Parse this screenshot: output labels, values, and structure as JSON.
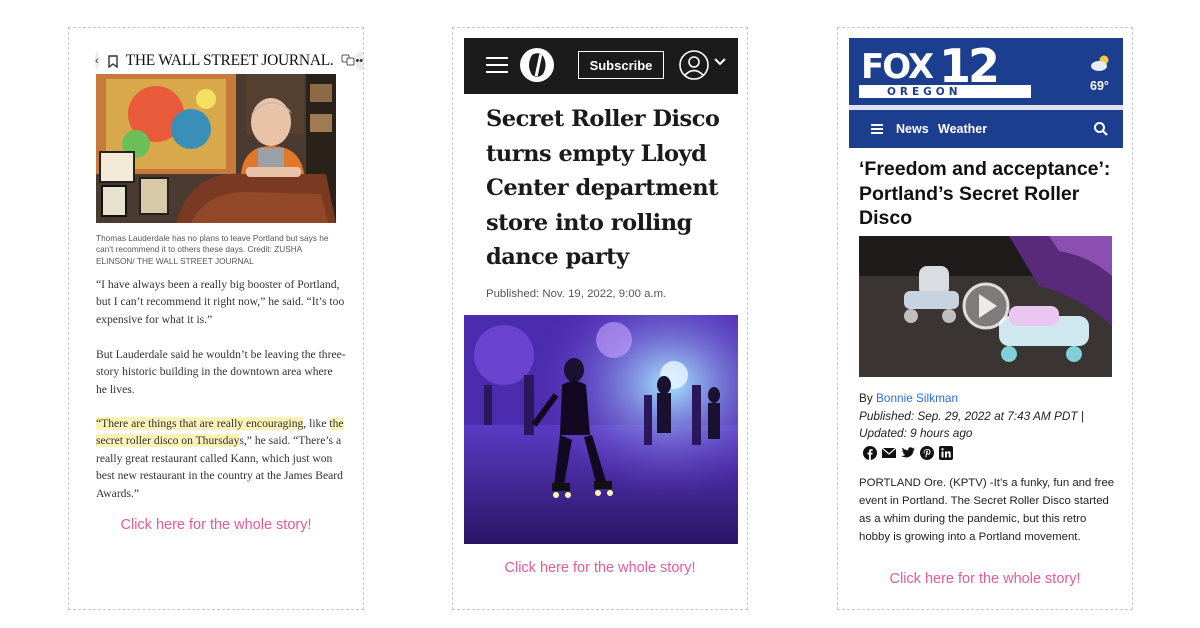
{
  "wsj": {
    "logo": "THE WALL STREET JOURNAL.",
    "caption": "Thomas Lauderdale has no plans to leave Portland but says he can't recommend it to others these days. Credit: ZUSHA ELINSON/ THE WALL STREET JOURNAL",
    "p1": "“I have always been a really big booster of Portland, but I can’t recommend it right now,” he said. “It’s too expensive for what it is.”",
    "p2": "But Lauderdale said he wouldn’t be leaving the three-story historic building in the downtown area where he lives.",
    "p3_hl1": "“There are things that are really encouraging",
    "p3_a": ", like ",
    "p3_hl2": "the secret roller disco on Thursday",
    "p3_b": "s,” he said. “There’s a really great restaurant called Kann, which just won best new restaurant in the country at the James Beard Awards.”",
    "cta": "Click here for the whole story!"
  },
  "oregonian": {
    "subscribe": "Subscribe",
    "headline": "Secret Roller Disco turns empty Lloyd Center department store into rolling dance party",
    "published": "Published: Nov. 19, 2022, 9:00 a.m.",
    "cta": "Click here for the whole story!"
  },
  "fox": {
    "logo_word": "FOX",
    "logo_num": "12",
    "logo_sub": "OREGON",
    "temp": "69°",
    "nav_news": "News",
    "nav_weather": "Weather",
    "headline": "‘Freedom and acceptance’: Portland’s Secret Roller Disco",
    "by": "By ",
    "author": "Bonnie Silkman",
    "published": "Published: Sep. 29, 2022 at 7:43 AM PDT",
    "separator": "|",
    "updated": "Updated: 9 hours ago",
    "body": "PORTLAND Ore. (KPTV) -It’s a funky, fun and free event in Portland. The Secret Roller Disco started as a whim during the pandemic, but this retro hobby is growing into a Portland movement.",
    "cta": "Click here for the whole story!"
  }
}
